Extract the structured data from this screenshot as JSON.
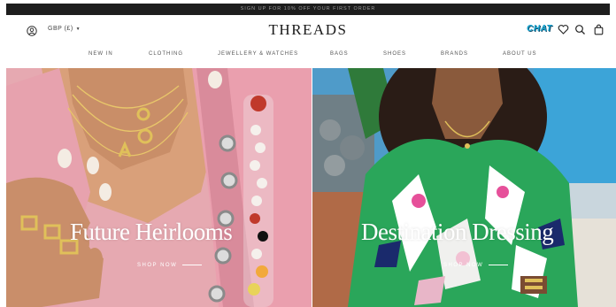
{
  "promo": {
    "text": "SIGN UP FOR 10% OFF YOUR FIRST ORDER"
  },
  "header": {
    "currency": "GBP (£)",
    "logo": "THREADS",
    "chat_label": "CHAT"
  },
  "nav": {
    "items": [
      "NEW IN",
      "CLOTHING",
      "JEWELLERY & WATCHES",
      "BAGS",
      "SHOES",
      "BRANDS",
      "ABOUT US"
    ]
  },
  "heroes": [
    {
      "title": "Future Heirlooms",
      "cta": "SHOP NOW"
    },
    {
      "title": "Destination Dressing",
      "cta": "SHOP NOW"
    }
  ],
  "colors": {
    "promo_bg": "#1e1e1e",
    "chat_accent": "#1aa6d1",
    "hero_left_bg": "#e3a7ae",
    "hero_right_bg": "#4f9bc9"
  },
  "icons": [
    "account-icon",
    "chevron-down-icon",
    "heart-icon",
    "search-icon",
    "shopping-bag-icon",
    "arrow-right-icon"
  ]
}
